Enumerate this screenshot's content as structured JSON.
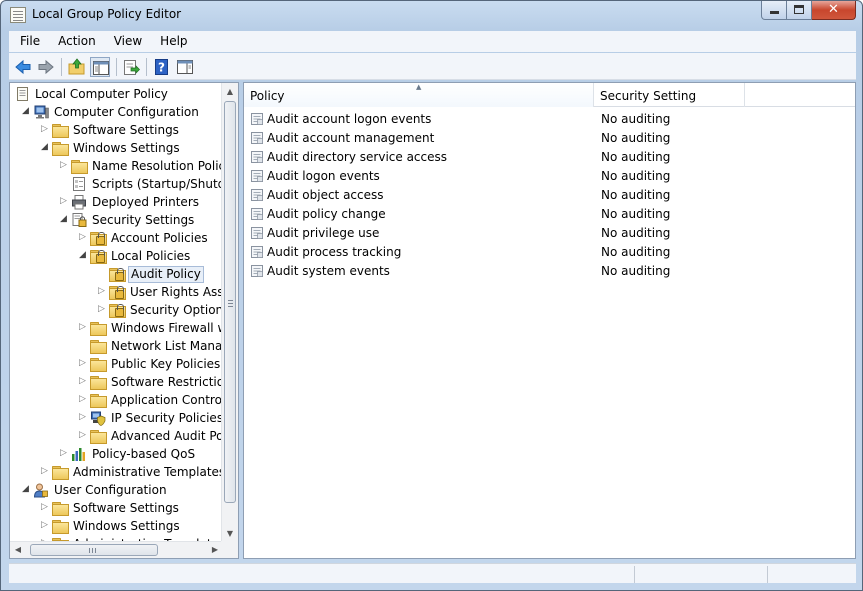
{
  "window": {
    "title": "Local Group Policy Editor"
  },
  "menu": [
    "File",
    "Action",
    "View",
    "Help"
  ],
  "toolbar": {
    "buttons": [
      "back-icon",
      "forward-icon",
      "up-folder-icon",
      "show-hide-console-tree-icon",
      "export-list-icon",
      "help-icon",
      "show-action-pane-icon"
    ]
  },
  "tree": [
    {
      "label": "Local Computer Policy",
      "depth": 0,
      "arrow": "",
      "icon": "policy-doc-icon"
    },
    {
      "label": "Computer Configuration",
      "depth": 1,
      "arrow": "expanded",
      "icon": "computer-icon"
    },
    {
      "label": "Software Settings",
      "depth": 2,
      "arrow": "collapsed",
      "icon": "folder-icon"
    },
    {
      "label": "Windows Settings",
      "depth": 2,
      "arrow": "expanded",
      "icon": "folder-icon"
    },
    {
      "label": "Name Resolution Policy",
      "depth": 3,
      "arrow": "collapsed",
      "icon": "folder-icon"
    },
    {
      "label": "Scripts (Startup/Shutdov",
      "depth": 3,
      "arrow": "",
      "icon": "script-icon"
    },
    {
      "label": "Deployed Printers",
      "depth": 3,
      "arrow": "collapsed",
      "icon": "printer-icon"
    },
    {
      "label": "Security Settings",
      "depth": 3,
      "arrow": "expanded",
      "icon": "security-settings-icon"
    },
    {
      "label": "Account Policies",
      "depth": 4,
      "arrow": "collapsed",
      "icon": "locked-folder-icon"
    },
    {
      "label": "Local Policies",
      "depth": 4,
      "arrow": "expanded",
      "icon": "locked-folder-icon"
    },
    {
      "label": "Audit Policy",
      "depth": 5,
      "arrow": "",
      "icon": "locked-folder-icon",
      "selected": true
    },
    {
      "label": "User Rights Assig",
      "depth": 5,
      "arrow": "collapsed",
      "icon": "locked-folder-icon"
    },
    {
      "label": "Security Options",
      "depth": 5,
      "arrow": "collapsed",
      "icon": "locked-folder-icon"
    },
    {
      "label": "Windows Firewall wit",
      "depth": 4,
      "arrow": "collapsed",
      "icon": "folder-icon"
    },
    {
      "label": "Network List Manage",
      "depth": 4,
      "arrow": "",
      "icon": "folder-icon"
    },
    {
      "label": "Public Key Policies",
      "depth": 4,
      "arrow": "collapsed",
      "icon": "folder-icon"
    },
    {
      "label": "Software Restriction",
      "depth": 4,
      "arrow": "collapsed",
      "icon": "folder-icon"
    },
    {
      "label": "Application Control I",
      "depth": 4,
      "arrow": "collapsed",
      "icon": "folder-icon"
    },
    {
      "label": "IP Security Policies o",
      "depth": 4,
      "arrow": "collapsed",
      "icon": "ip-security-icon"
    },
    {
      "label": "Advanced Audit Poli",
      "depth": 4,
      "arrow": "collapsed",
      "icon": "folder-icon"
    },
    {
      "label": "Policy-based QoS",
      "depth": 3,
      "arrow": "collapsed",
      "icon": "qos-chart-icon"
    },
    {
      "label": "Administrative Templates",
      "depth": 2,
      "arrow": "collapsed",
      "icon": "folder-icon"
    },
    {
      "label": "User Configuration",
      "depth": 1,
      "arrow": "expanded",
      "icon": "user-icon"
    },
    {
      "label": "Software Settings",
      "depth": 2,
      "arrow": "collapsed",
      "icon": "folder-icon"
    },
    {
      "label": "Windows Settings",
      "depth": 2,
      "arrow": "collapsed",
      "icon": "folder-icon"
    },
    {
      "label": "Administrative Templates",
      "depth": 2,
      "arrow": "collapsed",
      "icon": "folder-icon"
    }
  ],
  "list": {
    "columns": [
      "Policy",
      "Security Setting"
    ],
    "rows": [
      {
        "policy": "Audit account logon events",
        "setting": "No auditing"
      },
      {
        "policy": "Audit account management",
        "setting": "No auditing"
      },
      {
        "policy": "Audit directory service access",
        "setting": "No auditing"
      },
      {
        "policy": "Audit logon events",
        "setting": "No auditing"
      },
      {
        "policy": "Audit object access",
        "setting": "No auditing"
      },
      {
        "policy": "Audit policy change",
        "setting": "No auditing"
      },
      {
        "policy": "Audit privilege use",
        "setting": "No auditing"
      },
      {
        "policy": "Audit process tracking",
        "setting": "No auditing"
      },
      {
        "policy": "Audit system events",
        "setting": "No auditing"
      }
    ]
  }
}
